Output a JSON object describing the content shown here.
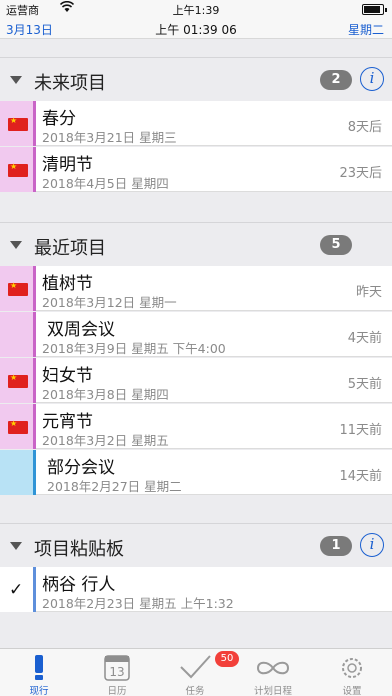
{
  "status_bar": {
    "carrier": "运营商",
    "time": "上午1:39"
  },
  "top_bar": {
    "date": "3月13日",
    "clock": "上午 01:39 06",
    "weekday": "星期二"
  },
  "sections": [
    {
      "title": "未来项目",
      "count": "2"
    },
    {
      "title": "最近项目",
      "count": "5"
    },
    {
      "title": "项目粘贴板",
      "count": "1"
    }
  ],
  "upcoming": [
    {
      "name": "春分",
      "date": "2018年3月21日 星期三",
      "relative": "8天后"
    },
    {
      "name": "清明节",
      "date": "2018年4月5日 星期四",
      "relative": "23天后"
    }
  ],
  "recent": [
    {
      "name": "植树节",
      "date": "2018年3月12日 星期一",
      "relative": "昨天"
    },
    {
      "name": "双周会议",
      "date": "2018年3月9日 星期五 下午4:00",
      "relative": "4天前"
    },
    {
      "name": "妇女节",
      "date": "2018年3月8日 星期四",
      "relative": "5天前"
    },
    {
      "name": "元宵节",
      "date": "2018年3月2日 星期五",
      "relative": "11天前"
    },
    {
      "name": "部分会议",
      "date": "2018年2月27日 星期二",
      "relative": "14天前"
    }
  ],
  "clipboard": [
    {
      "name": "柄谷 行人",
      "date": "2018年2月23日 星期五 上午1:32"
    }
  ],
  "icons": {
    "info": "i",
    "check": "✓",
    "calendar_day": "13"
  },
  "tabs": [
    {
      "label": "现行",
      "icon": "exclamation-icon"
    },
    {
      "label": "日历",
      "icon": "calendar-icon"
    },
    {
      "label": "任务",
      "icon": "checkmark-icon"
    },
    {
      "label": "计划日程",
      "icon": "infinity-icon",
      "badge": "50"
    },
    {
      "label": "设置",
      "icon": "gear-icon"
    }
  ],
  "colors": {
    "accent": "#1a5fd0",
    "holiday": "#c964c7",
    "meeting": "#2f94d6",
    "badge": "#f2403a"
  }
}
